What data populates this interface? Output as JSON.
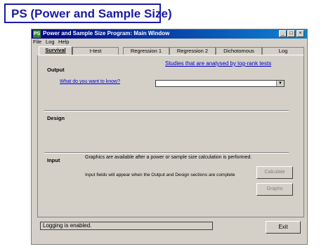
{
  "slide": {
    "title": "PS (Power and Sample Size)"
  },
  "window": {
    "icon_text": "PS",
    "title": "Power and Sample Size Program:  Main Window",
    "controls": {
      "minimize": "_",
      "maximize": "□",
      "close": "×"
    }
  },
  "menu": [
    "File",
    "Log",
    "Help"
  ],
  "tabs": [
    "Survival",
    "t-test",
    "Regression 1",
    "Regression 2",
    "Dichotomous",
    "Log"
  ],
  "active_tab": "Survival",
  "survival": {
    "link_studies": "Studies that are analysed by log-rank tests",
    "output_label": "Output",
    "what_label": "What do you want to know?",
    "select_value": "",
    "design_label": "Design",
    "input_label": "Input",
    "graphics_note": "Graphics are available after a power or sample size calculation is performed.",
    "input_note": "Input fields will appear when the Output and Design sections are complete",
    "calculate_label": "Calculate",
    "graphs_label": "Graphs"
  },
  "status": {
    "text": "Logging is enabled."
  },
  "exit_label": "Exit"
}
